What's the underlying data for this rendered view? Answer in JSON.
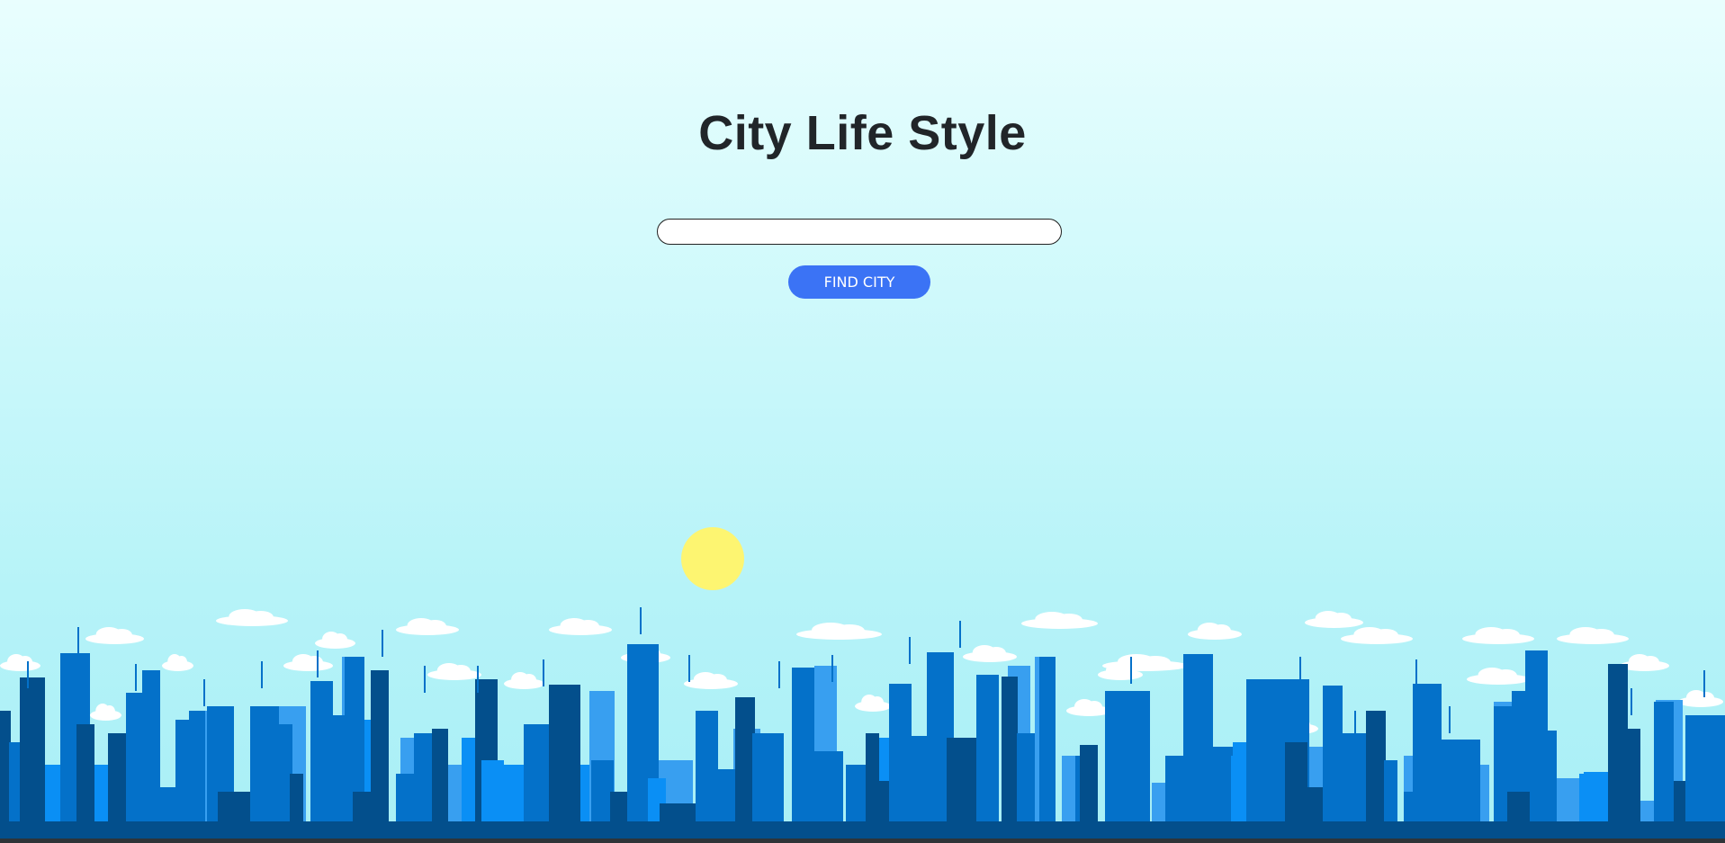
{
  "page": {
    "title": "City Life Style"
  },
  "search": {
    "value": "",
    "placeholder": ""
  },
  "actions": {
    "find_city_label": "FIND CITY"
  },
  "colors": {
    "sky_top": "#e9fefe",
    "sky_bottom": "#a8eff6",
    "title_text": "#212529",
    "button_bg": "#3b73f5",
    "button_text": "#ffffff",
    "sun": "#fdf571",
    "building_dark": "#034f8c",
    "building_mid": "#0471c9",
    "building_bright": "#0a8ff5",
    "building_light": "#389ff0",
    "cloud": "#ffffff"
  },
  "icons": {
    "sun": "sun-icon",
    "skyline": "city-skyline-illustration"
  }
}
